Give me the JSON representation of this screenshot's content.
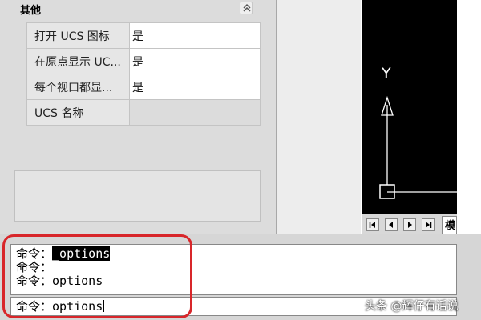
{
  "palette": {
    "section_title": "其他",
    "rows": [
      {
        "name": "打开 UCS 图标",
        "value": "是"
      },
      {
        "name": "在原点显示 UC...",
        "value": "是"
      },
      {
        "name": "每个视口都显...",
        "value": "是"
      },
      {
        "name": "UCS 名称",
        "value": ""
      }
    ]
  },
  "drawing": {
    "axis_label": "Y",
    "model_tab_label": "模"
  },
  "command": {
    "history": [
      {
        "prompt": "命令：",
        "text": "_options"
      },
      {
        "prompt": "命令：",
        "text": ""
      },
      {
        "prompt": "命令：",
        "text": "options"
      }
    ],
    "input_prompt": "命令：",
    "input_value": "options"
  },
  "colors": {
    "annotation": "#d8262a",
    "drawing_bg": "#000000",
    "ucs_icon": "#ffffff"
  },
  "watermark": "头条 @辉仔有话说"
}
